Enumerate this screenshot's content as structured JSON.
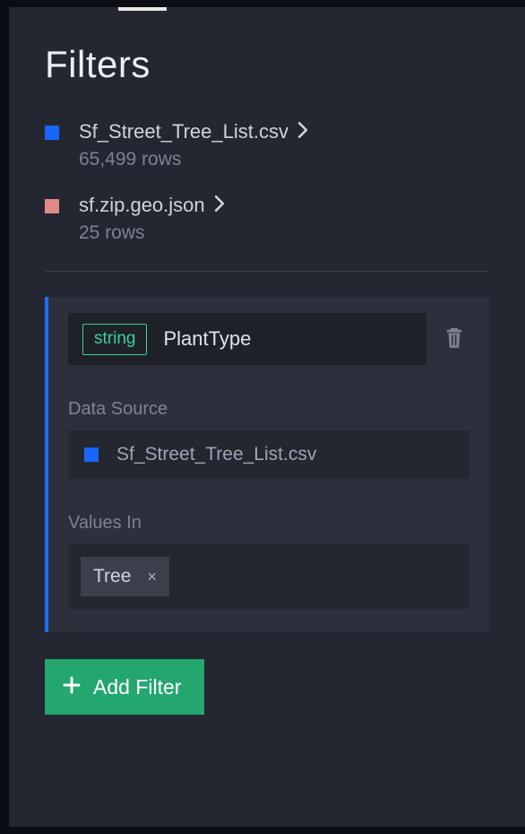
{
  "panel": {
    "title": "Filters"
  },
  "datasets": [
    {
      "name": "Sf_Street_Tree_List.csv",
      "rows": "65,499 rows",
      "color": "#1966ff"
    },
    {
      "name": "sf.zip.geo.json",
      "rows": "25 rows",
      "color": "#e18a8a"
    }
  ],
  "filter": {
    "field_type": "string",
    "field_name": "PlantType",
    "data_source_label": "Data Source",
    "data_source_name": "Sf_Street_Tree_List.csv",
    "data_source_color": "#1966ff",
    "values_label": "Values In",
    "values": [
      {
        "label": "Tree"
      }
    ]
  },
  "actions": {
    "add_filter": "Add Filter"
  }
}
